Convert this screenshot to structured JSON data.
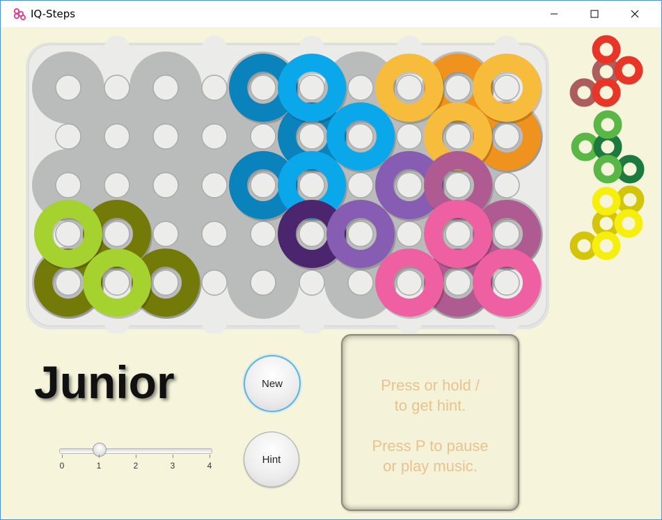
{
  "window": {
    "title": "IQ-Steps",
    "app_icon": "iq-steps-logo-icon",
    "controls": {
      "minimize": "minimize-icon",
      "maximize": "maximize-icon",
      "close": "close-icon"
    }
  },
  "level": {
    "name": "Junior"
  },
  "buttons": {
    "new_label": "New",
    "hint_label": "Hint"
  },
  "difficulty_slider": {
    "value": 1,
    "min": 0,
    "max": 4,
    "tick_labels": [
      "0",
      "1",
      "2",
      "3",
      "4"
    ]
  },
  "hint_panel": {
    "lines": [
      "Press or hold /",
      "to get hint.",
      "",
      "Press P to pause",
      "or play music."
    ]
  },
  "colors": {
    "board": "#babbbb",
    "hole": "#ececea",
    "background": "#f6f5dc",
    "hint_text": "#e7c38d",
    "pieces": {
      "dark_blue": "#0a82bb",
      "light_blue": "#0aa8ea",
      "orange": "#f0931e",
      "light_orange": "#f7bc3c",
      "dark_purple": "#4b266e",
      "purple": "#865db2",
      "magenta": "#b05a92",
      "pink": "#ee60a2",
      "olive": "#737a07",
      "lime": "#a6d22f",
      "red": "#e83527",
      "brown": "#ac5e5e",
      "green": "#59b746",
      "dark_green": "#1c7a3e",
      "yellow": "#f6ee0c",
      "dark_yellow": "#d3c60a"
    }
  }
}
